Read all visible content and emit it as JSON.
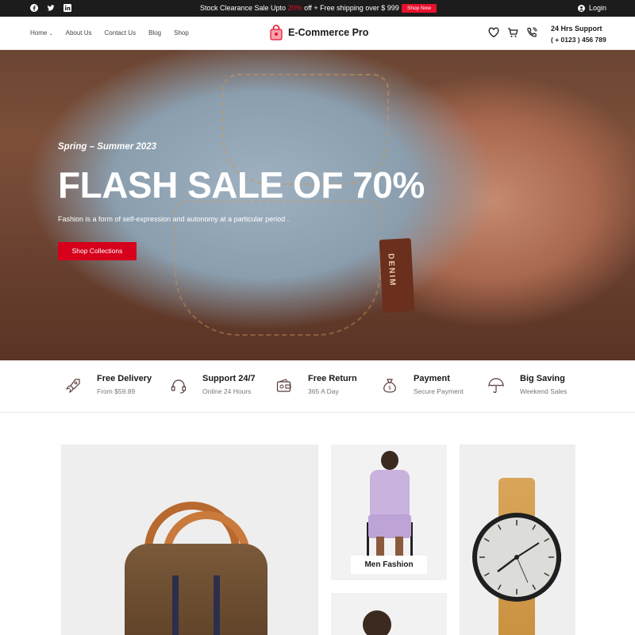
{
  "topbar": {
    "socials": [
      "facebook-icon",
      "twitter-icon",
      "linkedin-icon"
    ],
    "promo_before": "Stock Clearance Sale Upto ",
    "promo_percent": "20%",
    "promo_after": " off + Free shipping over $ 999 ✨",
    "shop_now": "Shop Now",
    "login": "Login"
  },
  "header": {
    "nav": [
      "Home",
      "About Us",
      "Contact Us",
      "Blog",
      "Shop"
    ],
    "brand": "E-Commerce Pro",
    "support_title": "24 Hrs Support",
    "support_phone": "( + 0123 ) 456 789"
  },
  "hero": {
    "season": "Spring – Summer 2023",
    "headline": "FLASH SALE OF 70%",
    "subtitle": "Fashion is a form of self-expression and autonomy at a particular period .",
    "cta": "Shop Collections",
    "tag_text": "DENIM"
  },
  "features": [
    {
      "icon": "rocket-icon",
      "title": "Free Delivery",
      "sub": "From $59.89"
    },
    {
      "icon": "headset-icon",
      "title": "Support 24/7",
      "sub": "Online 24 Hours"
    },
    {
      "icon": "wallet-icon",
      "title": "Free Return",
      "sub": "365 A Day"
    },
    {
      "icon": "money-bag-icon",
      "title": "Payment",
      "sub": "Secure Payment"
    },
    {
      "icon": "umbrella-icon",
      "title": "Big Saving",
      "sub": "Weekend Sales"
    }
  ],
  "products": {
    "men_label": "Men Fashion"
  },
  "colors": {
    "accent": "#e8112d",
    "dark": "#1c1c1c"
  }
}
